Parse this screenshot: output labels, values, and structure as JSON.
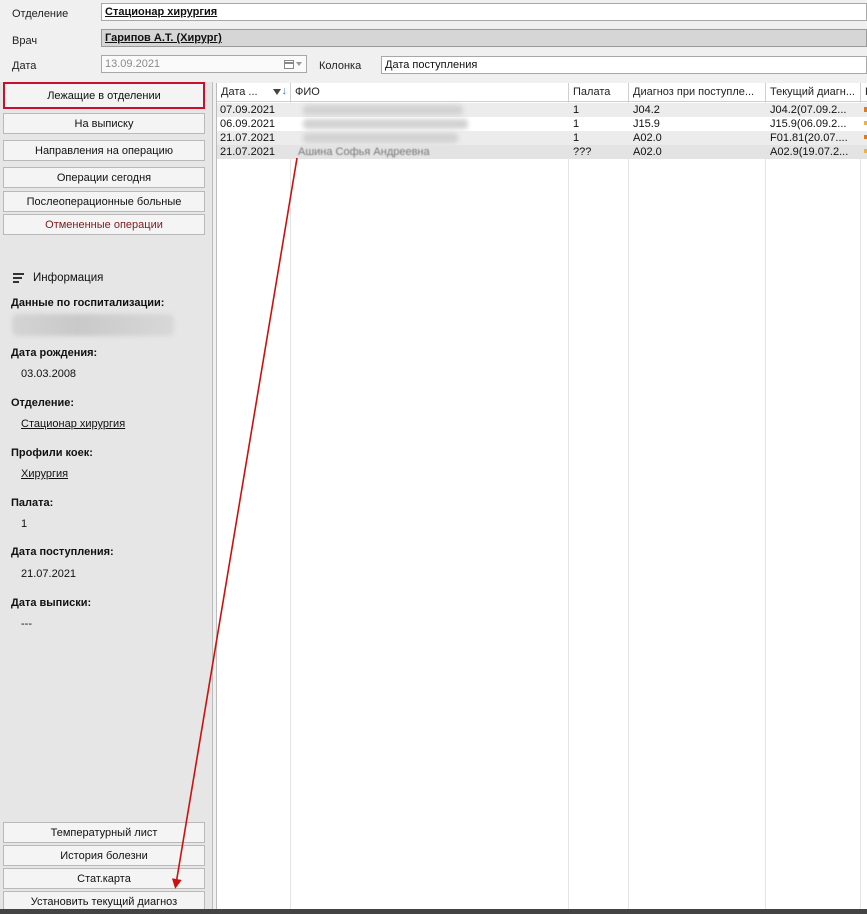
{
  "filters": {
    "department_label": "Отделение",
    "department_value": "Стационар  хирургия",
    "doctor_label": "Врач",
    "doctor_value": "Гарипов А.Т. (Хирург)",
    "date_label": "Дата",
    "date_value": "13.09.2021",
    "column_label": "Колонка",
    "column_value": "Дата поступления"
  },
  "nav": {
    "lying": "Лежащие в отделении",
    "discharge": "На выписку",
    "directions": "Направления на операцию",
    "today_ops": "Операции сегодня",
    "postop": "Послеоперационные больные",
    "cancelled": "Отмененные операции"
  },
  "info": {
    "title": "Информация",
    "hospitalization_label": "Данные по госпитализации:",
    "birth_label": "Дата рождения:",
    "birth_value": "03.03.2008",
    "department_label": "Отделение:",
    "department_value": "Стационар  хирургия",
    "bed_profile_label": "Профили коек:",
    "bed_profile_value": "Хирургия",
    "ward_label": "Палата:",
    "ward_value": "1",
    "admission_label": "Дата поступления:",
    "admission_value": "21.07.2021",
    "discharge_label": "Дата выписки:",
    "discharge_value": "---"
  },
  "actions": {
    "temp_sheet": "Температурный лист",
    "history": "История болезни",
    "stat_card": "Стат.карта",
    "set_diagnosis": "Установить текущий диагноз"
  },
  "grid": {
    "columns": [
      "Дата ...",
      "ФИО",
      "Палата",
      "Диагноз при поступле...",
      "Текущий диагн...",
      "Н"
    ],
    "rows": [
      {
        "date": "07.09.2021",
        "fio": "",
        "ward": "1",
        "adm_dx": "J04.2",
        "cur_dx": "J04.2(07.09.2..."
      },
      {
        "date": "06.09.2021",
        "fio": "",
        "ward": "1",
        "adm_dx": "J15.9",
        "cur_dx": "J15.9(06.09.2..."
      },
      {
        "date": "21.07.2021",
        "fio": "",
        "ward": "1",
        "adm_dx": "A02.0",
        "cur_dx": "F01.81(20.07...."
      },
      {
        "date": "21.07.2021",
        "fio": "Ашина Софья Андреевна",
        "ward": "???",
        "adm_dx": "A02.0",
        "cur_dx": "A02.9(19.07.2..."
      }
    ]
  },
  "colors": {
    "active_border": "#c8102e",
    "annotation_arrow": "#cc1111",
    "row_alt": "#ececec",
    "cancelled_text": "#7a1c1c"
  }
}
